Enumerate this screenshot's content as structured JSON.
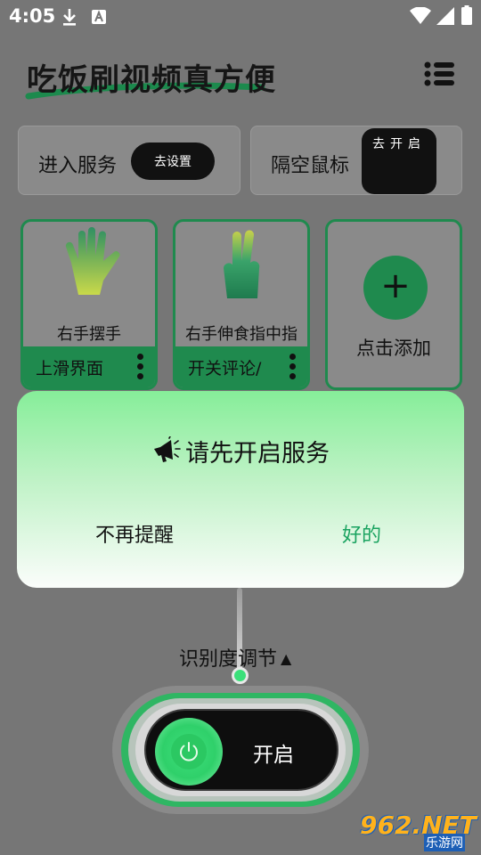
{
  "status_bar": {
    "time": "4:05"
  },
  "header": {
    "title": "吃饭刷视频真方便"
  },
  "service_cards": [
    {
      "label": "进入服务",
      "button": "去设置"
    },
    {
      "label": "隔空鼠标",
      "button": "去开启"
    }
  ],
  "gestures": [
    {
      "name": "右手摆手",
      "action": "上滑界面"
    },
    {
      "name": "右手伸食指中指",
      "action": "开关评论/"
    }
  ],
  "add_card": {
    "label": "点击添加"
  },
  "dialog": {
    "title": "请先开启服务",
    "dismiss": "不再提醒",
    "confirm": "好的"
  },
  "sensitivity": {
    "label": "识别度调节",
    "arrow": "▲"
  },
  "toggle": {
    "label": "开启"
  },
  "watermark": {
    "brand": "962.NET",
    "sub": "乐游网"
  },
  "colors": {
    "accent": "#1f8a4e",
    "confirm_text": "#1aa360",
    "dialog_top": "#86ee99"
  }
}
